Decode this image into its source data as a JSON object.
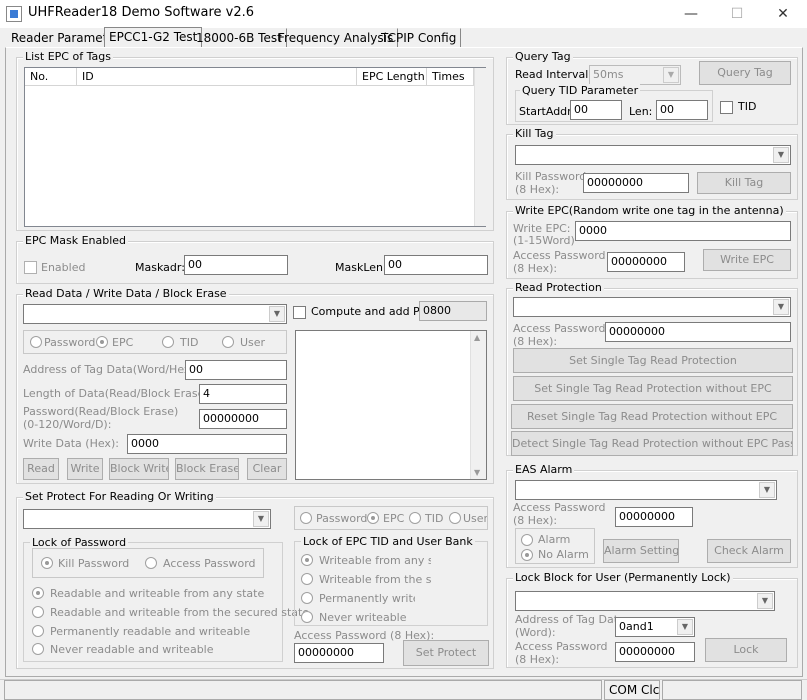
{
  "window": {
    "title": "UHFReader18 Demo Software v2.6",
    "minimize": "—",
    "maximize": "☐",
    "close": "✕"
  },
  "tabs": [
    {
      "label": "Reader Parameter"
    },
    {
      "label": "EPCC1-G2 Test"
    },
    {
      "label": "18000-6B Test"
    },
    {
      "label": "Frequency Analysis"
    },
    {
      "label": "TCPIP Config"
    }
  ],
  "list_epc": {
    "title": "List EPC of Tags",
    "columns": [
      "No.",
      "ID",
      "EPC Length",
      "Times"
    ]
  },
  "mask": {
    "title": "EPC Mask Enabled",
    "enabled_label": "Enabled",
    "maskadr_label": "Maskadr:",
    "maskadr_value": "00",
    "masklen_label": "MaskLen:",
    "masklen_value": "00"
  },
  "rw": {
    "title": "Read Data / Write Data / Block Erase",
    "compute_label": "Compute and add PC:",
    "compute_value": "0800",
    "bank_password": "Password",
    "bank_epc": "EPC",
    "bank_tid": "TID",
    "bank_user": "User",
    "addr_label": "Address of Tag Data(Word/Hex):",
    "addr_value": "00",
    "len_label": "Length of Data(Read/Block Erase:",
    "len_value": "4",
    "pwd_label1": "Password(Read/Block Erase)",
    "pwd_label2": "(0-120/Word/D):",
    "pwd_value": "00000000",
    "write_label": "Write Data (Hex):",
    "write_value": "0000",
    "btn_read": "Read",
    "btn_write": "Write",
    "btn_block_write": "Block Write",
    "btn_block_erase": "Block Erase",
    "btn_clear": "Clear"
  },
  "protect": {
    "title": "Set Protect For Reading Or Writing",
    "bank_password": "Password",
    "bank_epc": "EPC",
    "bank_tid": "TID",
    "bank_user": "User",
    "lock_pwd_title": "Lock of Password",
    "kill_password": "Kill Password",
    "access_password": "Access Password",
    "opt1": "Readable and  writeable from any state",
    "opt2": "Readable and writeable from the secured state",
    "opt3": "Permanently readable and writeable",
    "opt4": "Never readable and writeable",
    "lock_epc_title": "Lock of EPC TID and User Bank",
    "e1": "Writeable from any state",
    "e2": "Writeable from the secure",
    "e3": "Permanently writeab",
    "e4": "Never writeable",
    "access_label": "Access Password (8 Hex):",
    "access_value": "00000000",
    "btn_set": "Set Protect"
  },
  "query": {
    "title": "Query Tag",
    "interval_label": "Read Interval:",
    "interval_value": "50ms",
    "btn_query": "Query Tag",
    "tid_title": "Query TID Parameter",
    "start_label": "StartAddr:",
    "start_value": "00",
    "len_label": "Len:",
    "len_value": "00",
    "tid_label": "TID"
  },
  "kill": {
    "title": "Kill Tag",
    "pwd_label1": "Kill Password",
    "pwd_label2": "(8 Hex):",
    "pwd_value": "00000000",
    "btn": "Kill Tag"
  },
  "write_epc": {
    "title": "Write EPC(Random write one tag in the antenna)",
    "epc_label1": "Write EPC:",
    "epc_label2": "(1-15Word)",
    "epc_value": "0000",
    "pwd_label1": "Access Password",
    "pwd_label2": "(8 Hex):",
    "pwd_value": "00000000",
    "btn": "Write EPC"
  },
  "read_protect": {
    "title": "Read Protection",
    "pwd_label1": "Access Password",
    "pwd_label2": "(8 Hex):",
    "pwd_value": "00000000",
    "btn1": "Set Single Tag Read Protection",
    "btn2": "Set Single Tag Read Protection without EPC",
    "btn3": "Reset Single Tag Read Protection without EPC",
    "btn4": "Detect Single Tag Read Protection without EPC Password"
  },
  "eas": {
    "title": "EAS Alarm",
    "pwd_label1": "Access Password",
    "pwd_label2": "(8 Hex):",
    "pwd_value": "00000000",
    "alarm": "Alarm",
    "no_alarm": "No Alarm",
    "btn_setting": "Alarm Setting",
    "btn_check": "Check Alarm"
  },
  "lock_block": {
    "title": "Lock Block for User (Permanently Lock)",
    "addr_label1": "Address of Tag Data",
    "addr_label2": "(Word):",
    "addr_value": "0and1",
    "pwd_label1": "Access Password",
    "pwd_label2": "(8 Hex):",
    "pwd_value": "00000000",
    "btn": "Lock"
  },
  "statusbar": {
    "port": "COM Clc"
  }
}
